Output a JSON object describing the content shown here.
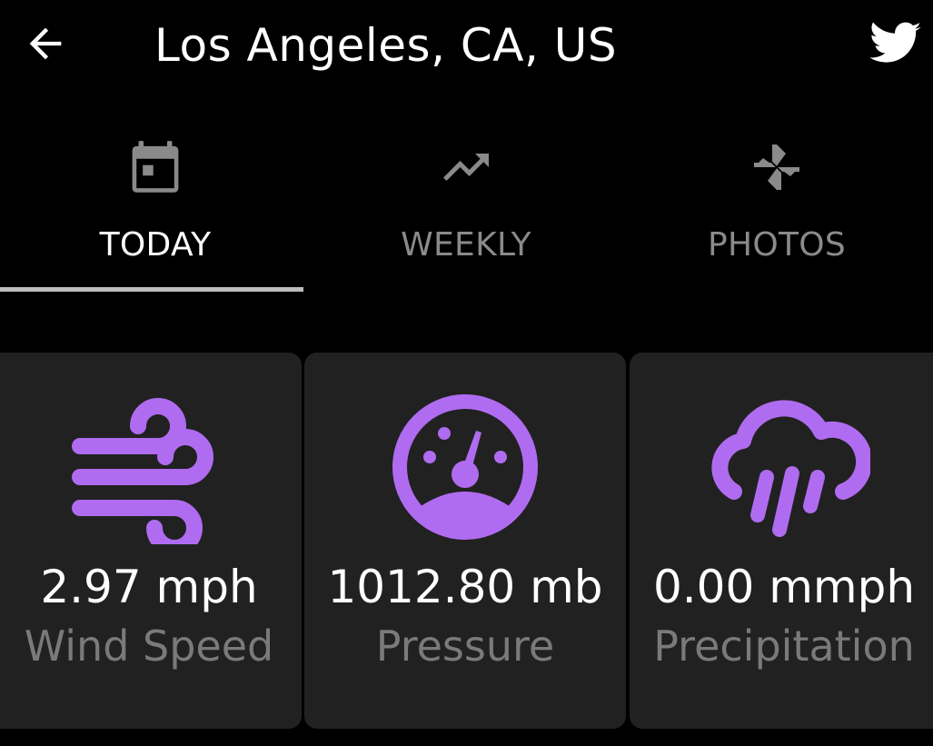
{
  "app_bar": {
    "title": "Los Angeles, CA, US",
    "back_icon": "arrow-back-icon",
    "share_icon": "twitter-icon"
  },
  "tabs": [
    {
      "label": "TODAY",
      "icon": "calendar-icon",
      "active": true
    },
    {
      "label": "WEEKLY",
      "icon": "trending-up-icon",
      "active": false
    },
    {
      "label": "PHOTOS",
      "icon": "pinwheel-icon",
      "active": false
    }
  ],
  "cards": [
    {
      "value": "2.97 mph",
      "label": "Wind Speed",
      "icon": "wind-icon"
    },
    {
      "value": "1012.80 mb",
      "label": "Pressure",
      "icon": "gauge-icon"
    },
    {
      "value": "0.00 mmph",
      "label": "Precipitation",
      "icon": "rain-cloud-icon"
    }
  ],
  "colors": {
    "background": "#000000",
    "card_background": "#212121",
    "accent": "#b06cf0",
    "text_primary": "#ffffff",
    "text_secondary": "#7a7a7a",
    "tab_inactive": "#8a8a8a",
    "tab_indicator": "#bdbdbd"
  }
}
